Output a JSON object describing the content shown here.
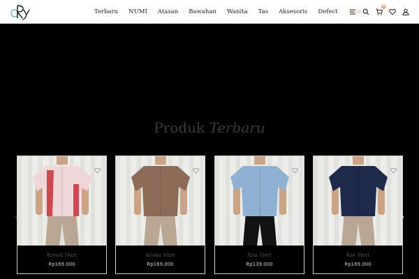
{
  "brand": {
    "logo_icon": "ry-logo-icon"
  },
  "nav": {
    "items": [
      {
        "label": "Terbaru"
      },
      {
        "label": "NUMI"
      },
      {
        "label": "Atasan"
      },
      {
        "label": "Bawahan"
      },
      {
        "label": "Wanita"
      },
      {
        "label": "Tas"
      },
      {
        "label": "Aksesoris"
      },
      {
        "label": "Defect"
      },
      {
        "label": "Sale"
      }
    ],
    "sale_color": "#d9b49a"
  },
  "header_icons": {
    "menu": "menu-icon",
    "search": "search-icon",
    "cart": "cart-icon",
    "cart_count": "0",
    "wishlist": "heart-icon",
    "account": "user-icon"
  },
  "section": {
    "title_plain": "Produk",
    "title_italic": "Terbaru"
  },
  "products": [
    {
      "name": "Kresid Shirt",
      "price": "Rp169.000",
      "shirt_color": "#f1d6d8",
      "accent": "#c4303a",
      "pants_color": "#b9a793"
    },
    {
      "name": "Atlaka Shirt",
      "price": "Rp169.000",
      "shirt_color": "#8c6b58",
      "accent": "#8c6b58",
      "pants_color": "#b9a793"
    },
    {
      "name": "Aria Shirt",
      "price": "Rp139.000",
      "shirt_color": "#8fb2d3",
      "accent": "#8fb2d3",
      "pants_color": "#111111"
    },
    {
      "name": "Kav Shirt",
      "price": "Rp169.000",
      "shirt_color": "#1f2a4a",
      "accent": "#1f2a4a",
      "pants_color": "#b9a793"
    }
  ],
  "carousel": {
    "prev": "chevron-left-icon",
    "next": "chevron-right-icon"
  }
}
